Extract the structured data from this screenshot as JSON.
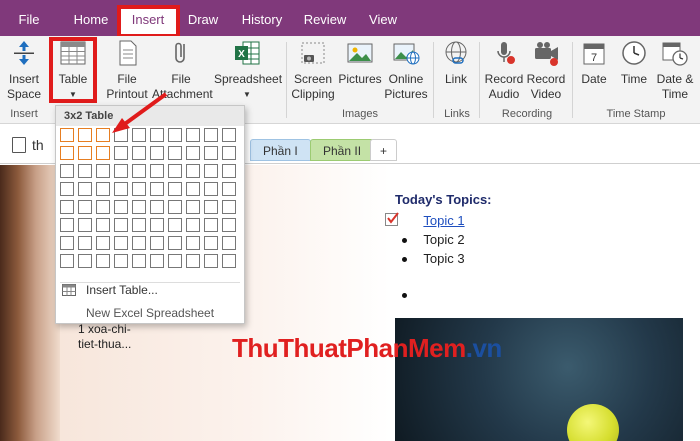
{
  "tabs": [
    "File",
    "Home",
    "Insert",
    "Draw",
    "History",
    "Review",
    "View"
  ],
  "ribbon": {
    "insert_space": "Insert\nSpace",
    "table": "Table",
    "file_printout": "File\nPrintout",
    "file_attachment": "File\nAttachment",
    "spreadsheet": "Spreadsheet",
    "screen_clipping": "Screen\nClipping",
    "pictures": "Pictures",
    "online_pictures": "Online\nPictures",
    "link": "Link",
    "record_audio": "Record\nAudio",
    "record_video": "Record\nVideo",
    "date": "Date",
    "time": "Time",
    "date_time": "Date &\nTime",
    "groups": {
      "insert": "Insert",
      "images": "Images",
      "links": "Links",
      "recording": "Recording",
      "time_stamp": "Time Stamp"
    }
  },
  "dropdown": {
    "header": "3x2 Table",
    "insert_table": "Insert Table...",
    "new_excel": "New Excel Spreadsheet",
    "selected_cols": 3,
    "selected_rows": 2
  },
  "notebook": {
    "title_partial": "th",
    "sections": [
      "Phần I",
      "Phần II",
      "+"
    ]
  },
  "page": {
    "topics_title": "Today's Topics:",
    "topics": [
      "Topic 1",
      "Topic 2",
      "Topic 3",
      ""
    ],
    "side_note_line1": "1 xoa-chi-",
    "side_note_line2": "tiet-thua..."
  },
  "watermark": {
    "part1": "ThuThuatPhanMem",
    "part2": ".vn"
  },
  "colors": {
    "onenote_purple": "#80397b",
    "highlight_red": "#e01b1b",
    "grid_selected": "#e67e22"
  }
}
